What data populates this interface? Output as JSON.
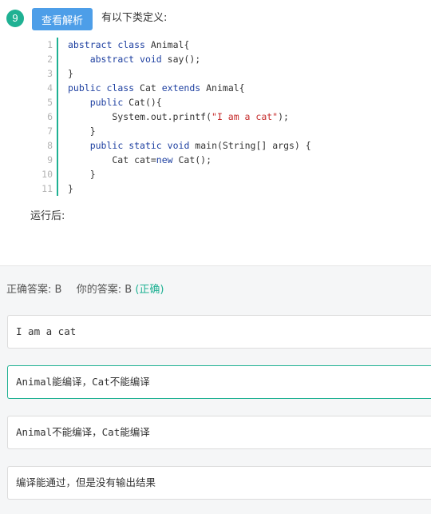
{
  "question": {
    "number": "9",
    "analysis_button": "查看解析",
    "text": "有以下类定义:",
    "after_label": "运行后:"
  },
  "code": {
    "lines": [
      {
        "n": "1",
        "parts": [
          {
            "t": "abstract",
            "k": "kw"
          },
          {
            "t": " "
          },
          {
            "t": "class",
            "k": "kw"
          },
          {
            "t": " Animal{"
          }
        ]
      },
      {
        "n": "2",
        "parts": [
          {
            "t": "    "
          },
          {
            "t": "abstract",
            "k": "kw"
          },
          {
            "t": " "
          },
          {
            "t": "void",
            "k": "kw"
          },
          {
            "t": " say();"
          }
        ]
      },
      {
        "n": "3",
        "parts": [
          {
            "t": "}"
          }
        ]
      },
      {
        "n": "4",
        "parts": [
          {
            "t": "public",
            "k": "kw"
          },
          {
            "t": " "
          },
          {
            "t": "class",
            "k": "kw"
          },
          {
            "t": " Cat "
          },
          {
            "t": "extends",
            "k": "kw"
          },
          {
            "t": " Animal{"
          }
        ]
      },
      {
        "n": "5",
        "parts": [
          {
            "t": "    "
          },
          {
            "t": "public",
            "k": "kw"
          },
          {
            "t": " Cat(){"
          }
        ]
      },
      {
        "n": "6",
        "parts": [
          {
            "t": "        System.out.printf("
          },
          {
            "t": "\"I am a cat\"",
            "k": "str"
          },
          {
            "t": ");"
          }
        ]
      },
      {
        "n": "7",
        "parts": [
          {
            "t": "    }"
          }
        ]
      },
      {
        "n": "8",
        "parts": [
          {
            "t": "    "
          },
          {
            "t": "public",
            "k": "kw"
          },
          {
            "t": " "
          },
          {
            "t": "static",
            "k": "kw"
          },
          {
            "t": " "
          },
          {
            "t": "void",
            "k": "kw"
          },
          {
            "t": " main(String[] args) {"
          }
        ]
      },
      {
        "n": "9",
        "parts": [
          {
            "t": "        Cat cat="
          },
          {
            "t": "new",
            "k": "kw"
          },
          {
            "t": " Cat();"
          }
        ]
      },
      {
        "n": "10",
        "parts": [
          {
            "t": "    }"
          }
        ]
      },
      {
        "n": "11",
        "parts": [
          {
            "t": "}"
          }
        ]
      }
    ]
  },
  "answer": {
    "correct_label": "正确答案:",
    "correct_value": "B",
    "yours_label": "你的答案:",
    "yours_value": "B",
    "status": "(正确)"
  },
  "options": [
    {
      "text": "I am a cat",
      "selected": false
    },
    {
      "text": "Animal能编译，Cat不能编译",
      "selected": true
    },
    {
      "text": "Animal不能编译，Cat能编译",
      "selected": false
    },
    {
      "text": "编译能通过，但是没有输出结果",
      "selected": false
    }
  ],
  "colors": {
    "accent_green": "#1fb193",
    "button_blue": "#4d9ee8",
    "keyword_blue": "#1d3fa0",
    "string_red": "#c62c2c"
  }
}
